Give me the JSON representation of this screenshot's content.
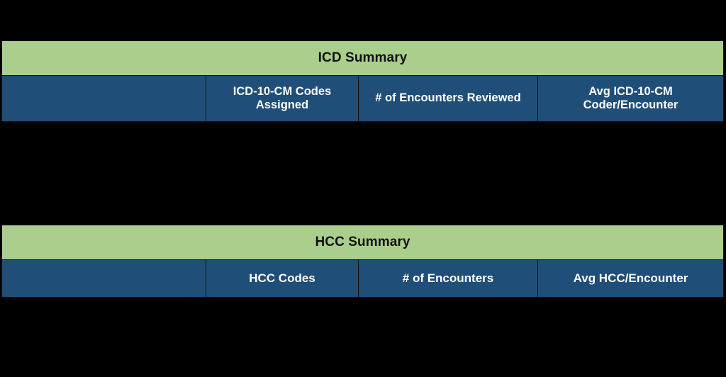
{
  "slide": {
    "background_color": "#000000",
    "accent_title_color": "#AACE8B",
    "accent_header_color": "#1F4E79",
    "title_text_color": "#111111",
    "header_text_color": "#FFFFFF"
  },
  "tables": [
    {
      "id": "icd-summary",
      "title": "ICD Summary",
      "columns": [
        "",
        "ICD-10-CM Codes Assigned",
        "# of Encounters Reviewed",
        "Avg ICD-10-CM Coder/Encounter"
      ],
      "rows": []
    },
    {
      "id": "hcc-summary",
      "title": "HCC Summary",
      "columns": [
        "",
        "HCC Codes",
        "# of Encounters",
        "Avg HCC/Encounter"
      ],
      "rows": []
    }
  ]
}
